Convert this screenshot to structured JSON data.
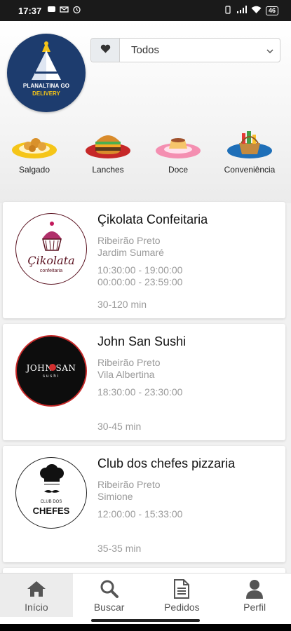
{
  "status": {
    "time": "17:37",
    "battery": "46"
  },
  "brand": {
    "line1": "PLANALTINA GO",
    "line2": "DELIVERY"
  },
  "filter": {
    "selected": "Todos",
    "favorite_icon": "heart-icon"
  },
  "categories": [
    {
      "label": "Salgado",
      "icon": "salgado-icon"
    },
    {
      "label": "Lanches",
      "icon": "burger-icon"
    },
    {
      "label": "Doce",
      "icon": "pudding-icon"
    },
    {
      "label": "Conveniência",
      "icon": "basket-icon"
    }
  ],
  "restaurants": [
    {
      "name": "Çikolata Confeitaria",
      "city": "Ribeirão Preto",
      "district": "Jardim Sumaré",
      "hours": [
        "10:30:00 - 19:00:00",
        "00:00:00 - 23:59:00"
      ],
      "eta": "30-120 min",
      "logo_text": "Çikolata",
      "logo_sub": "confeitaria"
    },
    {
      "name": "John San Sushi",
      "city": "Ribeirão Preto",
      "district": "Vila Albertina",
      "hours": [
        "18:30:00 - 23:30:00"
      ],
      "eta": "30-45 min",
      "logo_text": "JOHN SAN",
      "logo_sub": "sushi"
    },
    {
      "name": "Club dos chefes pizzaria",
      "city": "Ribeirão Preto",
      "district": "Simione",
      "hours": [
        "12:00:00 - 15:33:00"
      ],
      "eta": "35-35 min",
      "logo_text": "CHEFES",
      "logo_sub": "CLUB DOS"
    }
  ],
  "nav": [
    {
      "label": "Início",
      "icon": "home-icon"
    },
    {
      "label": "Buscar",
      "icon": "search-icon"
    },
    {
      "label": "Pedidos",
      "icon": "document-icon"
    },
    {
      "label": "Perfil",
      "icon": "user-icon"
    }
  ],
  "colors": {
    "accent_red": "#d32f2f",
    "brand_blue": "#1d3c6e",
    "brand_yellow": "#f5c518"
  }
}
